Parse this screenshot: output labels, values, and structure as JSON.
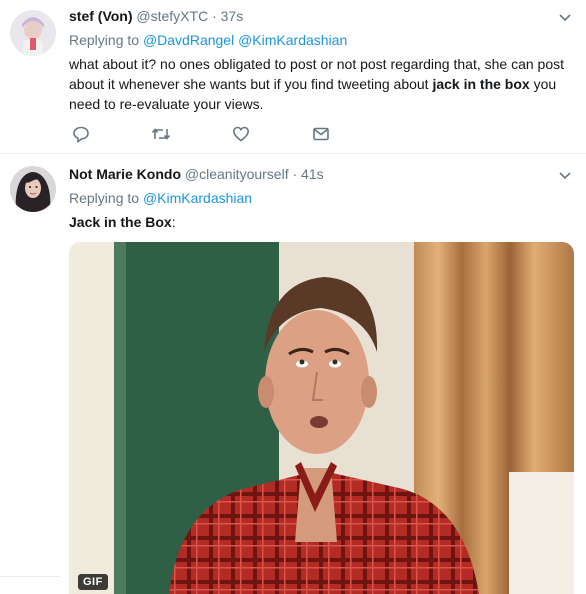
{
  "tweets": [
    {
      "name": "stef (Von)",
      "handle": "@stefyXTC",
      "dot": " · ",
      "time": "37s",
      "replying_prefix": "Replying to ",
      "mentions": [
        "@DavdRangel",
        "@KimKardashian"
      ],
      "text_before": "what about it? no ones obligated to post or not post regarding that, she can post about it whenever she wants but if you find tweeting about ",
      "text_bold": "jack in the box",
      "text_after": " you need to re-evaluate your views.",
      "actions": [
        "reply-icon",
        "retweet-icon",
        "like-icon",
        "direct-message-icon"
      ]
    },
    {
      "name": "Not Marie Kondo",
      "handle": "@cleanityourself",
      "dot": " · ",
      "time": "41s",
      "replying_prefix": "Replying to ",
      "mentions": [
        "@KimKardashian"
      ],
      "text_bold": "Jack in the Box",
      "text_after": ":",
      "media_badge": "GIF"
    }
  ],
  "colors": {
    "link": "#1b95e0",
    "secondary": "#657786",
    "primary": "#14171a",
    "divider": "#e6ecf0"
  }
}
